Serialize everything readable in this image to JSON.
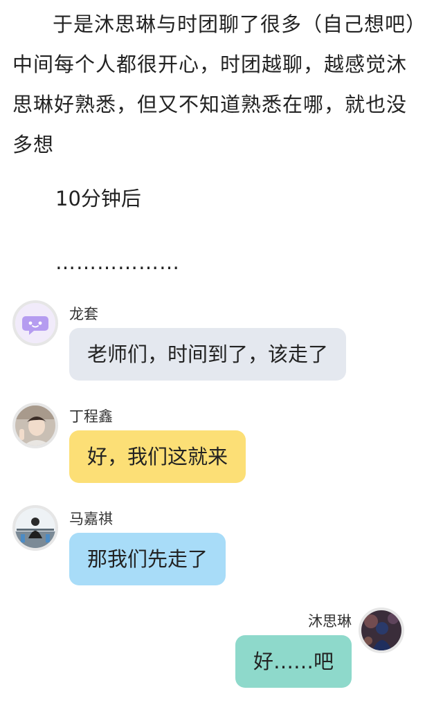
{
  "story": {
    "paragraph": "于是沐思琳与时团聊了很多（自己想吧）中间每个人都很开心，时团越聊，越感觉沐思琳好熟悉，但又不知道熟悉在哪，就也没多想",
    "time_note": "10分钟后",
    "dots": "………………"
  },
  "messages": [
    {
      "sender": "龙套",
      "text": "老师们，时间到了，该走了",
      "bubble_color": "#e4e8ef",
      "avatar_icon": "chat-bubble-icon",
      "avatar_color": "#b59cf0",
      "side": "left"
    },
    {
      "sender": "丁程鑫",
      "text": "好，我们这就来",
      "bubble_color": "#fcdf76",
      "avatar_icon": "photo-avatar",
      "side": "left"
    },
    {
      "sender": "马嘉祺",
      "text": "那我们先走了",
      "bubble_color": "#a8dcf8",
      "avatar_icon": "photo-avatar",
      "side": "left"
    },
    {
      "sender": "沐思琳",
      "text": "好……吧",
      "bubble_color": "#8ed9cb",
      "avatar_icon": "photo-avatar",
      "side": "right"
    }
  ]
}
